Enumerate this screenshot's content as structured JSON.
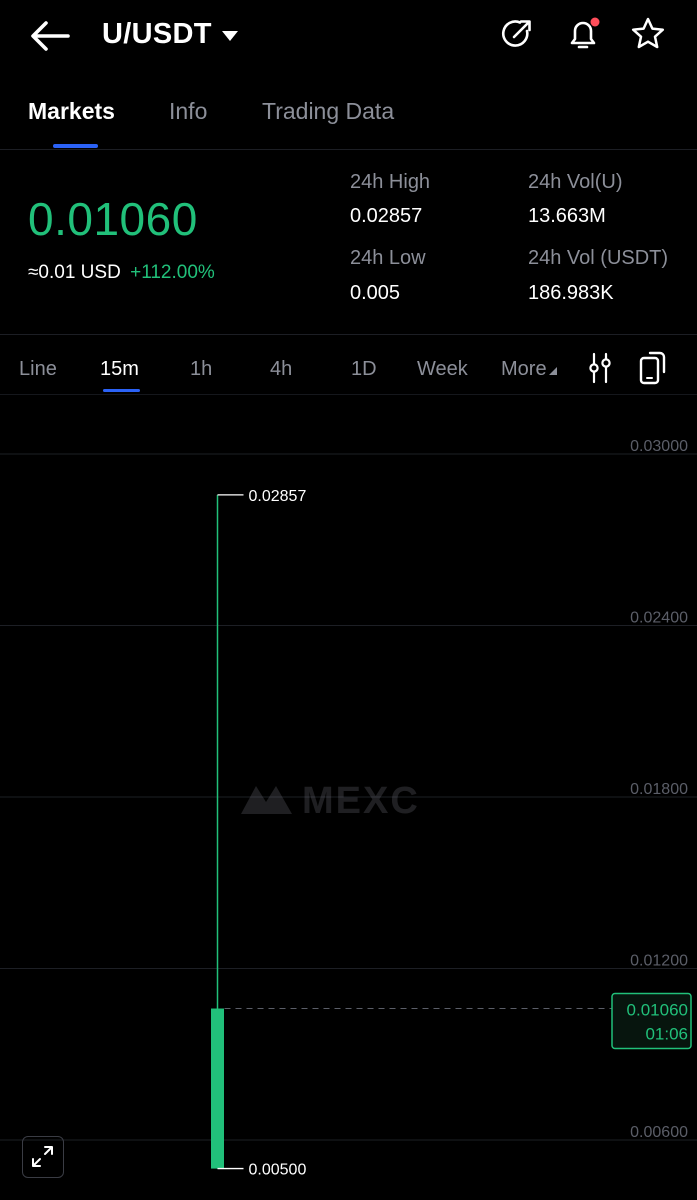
{
  "header": {
    "pair": "U/USDT",
    "icons": [
      "back-arrow-icon",
      "share-icon",
      "bell-icon",
      "star-icon"
    ],
    "notification_dot_color": "#ff4d5a"
  },
  "tabs": [
    {
      "label": "Markets",
      "active": true
    },
    {
      "label": "Info",
      "active": false
    },
    {
      "label": "Trading Data",
      "active": false
    }
  ],
  "ticker": {
    "price": "0.01060",
    "usd": "≈0.01 USD",
    "change": "+112.00%",
    "stats": {
      "high_label": "24h High",
      "high_value": "0.02857",
      "vol_u_label": "24h Vol(U)",
      "vol_u_value": "13.663M",
      "low_label": "24h Low",
      "low_value": "0.005",
      "vol_usdt_label": "24h Vol (USDT)",
      "vol_usdt_value": "186.983K"
    }
  },
  "intervals": {
    "items": [
      "Line",
      "15m",
      "1h",
      "4h",
      "1D",
      "Week",
      "More"
    ],
    "active": "15m"
  },
  "colors": {
    "up": "#21c07a",
    "accent": "#2b62f6",
    "text_muted": "#8c8f99"
  },
  "chart_data": {
    "type": "candlestick",
    "watermark": "MEXC",
    "y_ticks": [
      "0.03000",
      "0.02400",
      "0.01800",
      "0.01200",
      "0.00600"
    ],
    "y_tick_values": [
      0.03,
      0.024,
      0.018,
      0.012,
      0.006
    ],
    "candle": {
      "open": 0.005,
      "high": 0.02857,
      "low": 0.005,
      "close": 0.0106
    },
    "high_label": "0.02857",
    "low_label": "0.00500",
    "last_price_label": "0.01060",
    "countdown_label": "01:06"
  }
}
